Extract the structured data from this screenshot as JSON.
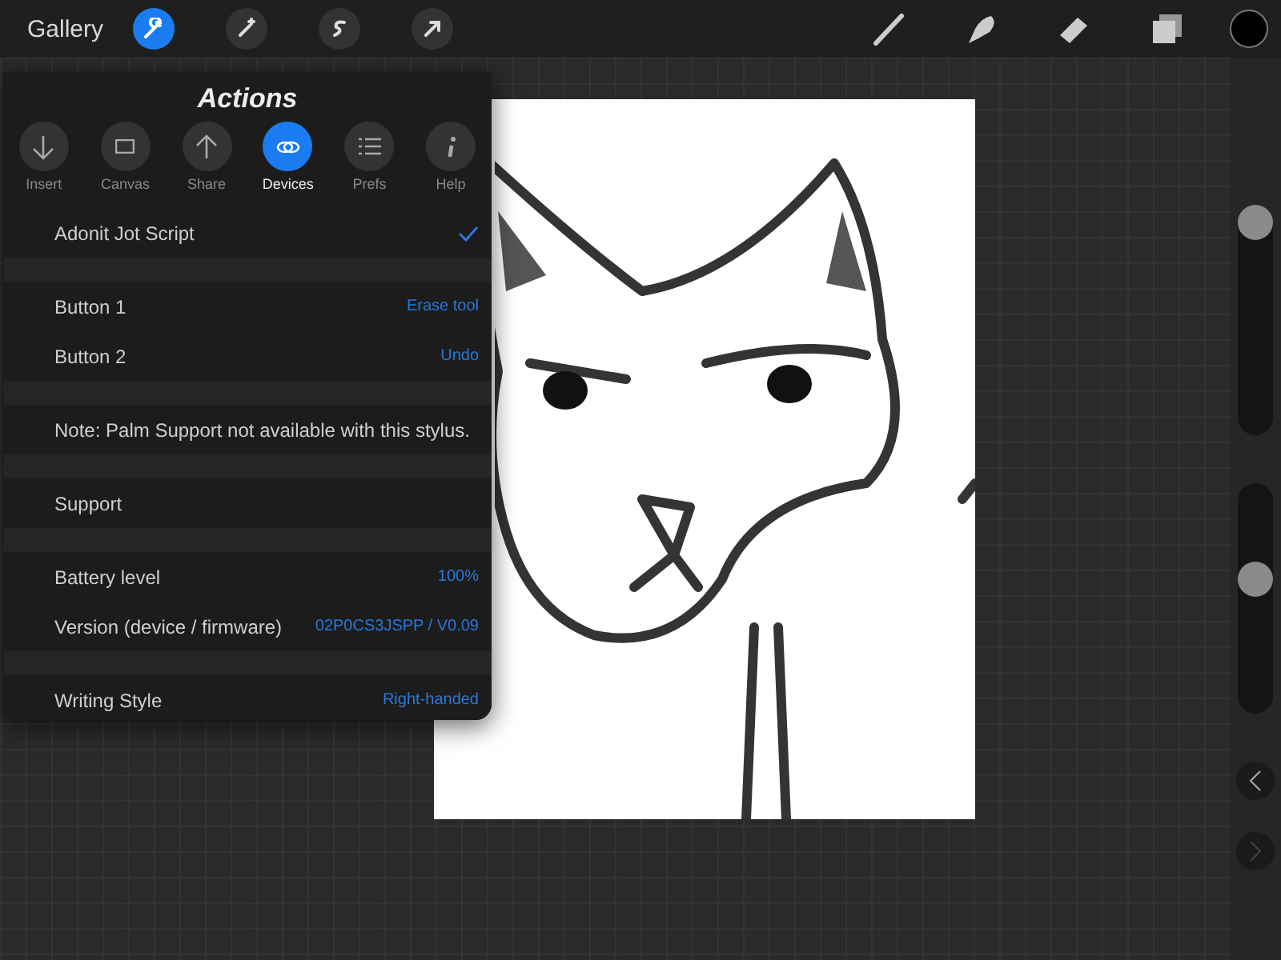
{
  "top_bar": {
    "gallery": "Gallery",
    "tools": [
      {
        "kind": "wrench",
        "selected": true
      },
      {
        "kind": "wand",
        "selected": false
      },
      {
        "kind": "selection",
        "selected": false
      },
      {
        "kind": "arrow",
        "selected": false
      }
    ],
    "right_tools": [
      {
        "kind": "brush"
      },
      {
        "kind": "smudge"
      },
      {
        "kind": "eraser"
      },
      {
        "kind": "layers"
      },
      {
        "kind": "color",
        "color": "#000000"
      }
    ]
  },
  "actions": {
    "title": "Actions",
    "tabs": [
      {
        "label": "Insert",
        "kind": "insert",
        "selected": false
      },
      {
        "label": "Canvas",
        "kind": "canvas",
        "selected": false
      },
      {
        "label": "Share",
        "kind": "share",
        "selected": false
      },
      {
        "label": "Devices",
        "kind": "devices",
        "selected": true
      },
      {
        "label": "Prefs",
        "kind": "prefs",
        "selected": false
      },
      {
        "label": "Help",
        "kind": "help",
        "selected": false
      }
    ],
    "sections": [
      [
        {
          "kind": "check",
          "label": "Adonit Jot Script",
          "checked": true
        }
      ],
      [
        {
          "kind": "value",
          "label": "Button 1",
          "value": "Erase tool"
        },
        {
          "kind": "value",
          "label": "Button 2",
          "value": "Undo"
        }
      ],
      [
        {
          "kind": "note",
          "label": "Note: Palm Support not available with this stylus."
        }
      ],
      [
        {
          "kind": "link",
          "label": "Support"
        }
      ],
      [
        {
          "kind": "value",
          "label": "Battery level",
          "value": "100%"
        },
        {
          "kind": "value",
          "label": "Version (device / firmware)",
          "value": "02P0CS3JSPP / V0.09"
        }
      ],
      [
        {
          "kind": "value",
          "label": "Writing Style",
          "value": "Right-handed"
        }
      ]
    ]
  },
  "side_bar": {
    "sliders": [
      {
        "level": 1
      },
      {
        "level": 0.6
      }
    ],
    "undo": {
      "disabled": false
    },
    "redo": {
      "disabled": true
    }
  }
}
